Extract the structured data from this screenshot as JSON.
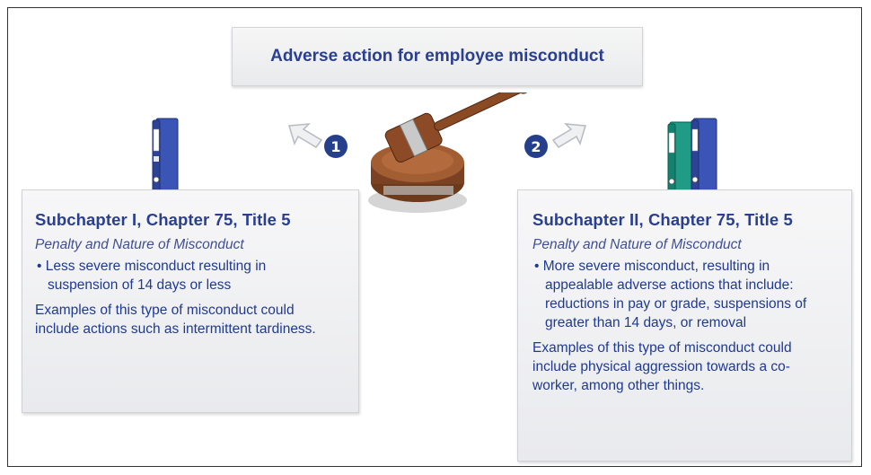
{
  "title": "Adverse action for employee misconduct",
  "markers": [
    "1",
    "2"
  ],
  "left_panel": {
    "heading": "Subchapter I, Chapter 75, Title 5",
    "subheading": "Penalty and Nature of Misconduct",
    "bullet": "• Less severe misconduct resulting in suspension of 14 days or less",
    "example": "Examples of this type of misconduct could include actions such as intermittent tardiness."
  },
  "right_panel": {
    "heading": "Subchapter II, Chapter 75, Title 5",
    "subheading": "Penalty and Nature of Misconduct",
    "bullet": "• More severe misconduct, resulting in appealable adverse actions that include: reductions in pay or grade, suspensions of greater than 14 days, or removal",
    "example": "Examples of this type of misconduct could include physical aggression towards a co-worker, among other things."
  },
  "icons": [
    "gavel-icon",
    "binder-icon",
    "arrow-icon"
  ],
  "colors": {
    "title_text": "#2a3f8f",
    "body_text": "#1f3a8f",
    "marker": "#263f8d",
    "binder_blue": "#3a55b5",
    "binder_teal": "#1f9b86"
  }
}
